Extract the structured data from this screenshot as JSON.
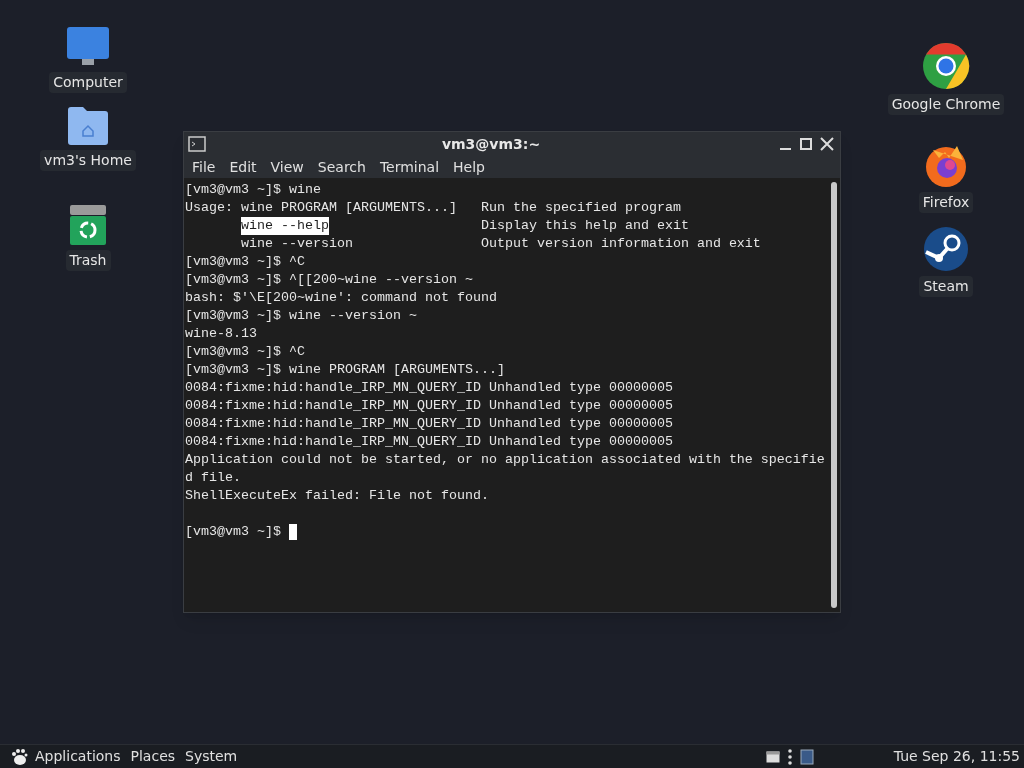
{
  "desktop_icons_left": [
    {
      "label": "Computer",
      "kind": "computer"
    },
    {
      "label": "vm3's Home",
      "kind": "home"
    },
    {
      "label": "Trash",
      "kind": "trash"
    }
  ],
  "desktop_icons_right": [
    {
      "label": "Google Chrome",
      "kind": "chrome"
    },
    {
      "label": "Firefox",
      "kind": "firefox"
    },
    {
      "label": "Steam",
      "kind": "steam"
    }
  ],
  "terminal": {
    "title": "vm3@vm3:~",
    "menu": [
      "File",
      "Edit",
      "View",
      "Search",
      "Terminal",
      "Help"
    ],
    "lines": [
      {
        "kind": "plain",
        "text": "[vm3@vm3 ~]$ wine"
      },
      {
        "kind": "plain",
        "text": "Usage: wine PROGRAM [ARGUMENTS...]   Run the specified program"
      },
      {
        "kind": "selection",
        "selected_text": "wine --help",
        "after": "                   Display this help and exit"
      },
      {
        "kind": "plain",
        "text": "       wine --version                Output version information and exit"
      },
      {
        "kind": "plain",
        "text": "[vm3@vm3 ~]$ ^C"
      },
      {
        "kind": "plain",
        "text": "[vm3@vm3 ~]$ ^[[200~wine --version ~"
      },
      {
        "kind": "plain",
        "text": "bash: $'\\E[200~wine': command not found"
      },
      {
        "kind": "plain",
        "text": "[vm3@vm3 ~]$ wine --version ~"
      },
      {
        "kind": "plain",
        "text": "wine-8.13"
      },
      {
        "kind": "plain",
        "text": "[vm3@vm3 ~]$ ^C"
      },
      {
        "kind": "plain",
        "text": "[vm3@vm3 ~]$ wine PROGRAM [ARGUMENTS...]"
      },
      {
        "kind": "plain",
        "text": "0084:fixme:hid:handle_IRP_MN_QUERY_ID Unhandled type 00000005"
      },
      {
        "kind": "plain",
        "text": "0084:fixme:hid:handle_IRP_MN_QUERY_ID Unhandled type 00000005"
      },
      {
        "kind": "plain",
        "text": "0084:fixme:hid:handle_IRP_MN_QUERY_ID Unhandled type 00000005"
      },
      {
        "kind": "plain",
        "text": "0084:fixme:hid:handle_IRP_MN_QUERY_ID Unhandled type 00000005"
      },
      {
        "kind": "plain",
        "text": "Application could not be started, or no application associated with the specifie"
      },
      {
        "kind": "plain",
        "text": "d file."
      },
      {
        "kind": "plain",
        "text": "ShellExecuteEx failed: File not found."
      },
      {
        "kind": "blank"
      },
      {
        "kind": "prompt",
        "text": "[vm3@vm3 ~]$ "
      }
    ]
  },
  "taskbar": {
    "menus": [
      "Applications",
      "Places",
      "System"
    ],
    "clock": "Tue Sep 26, 11:55"
  }
}
